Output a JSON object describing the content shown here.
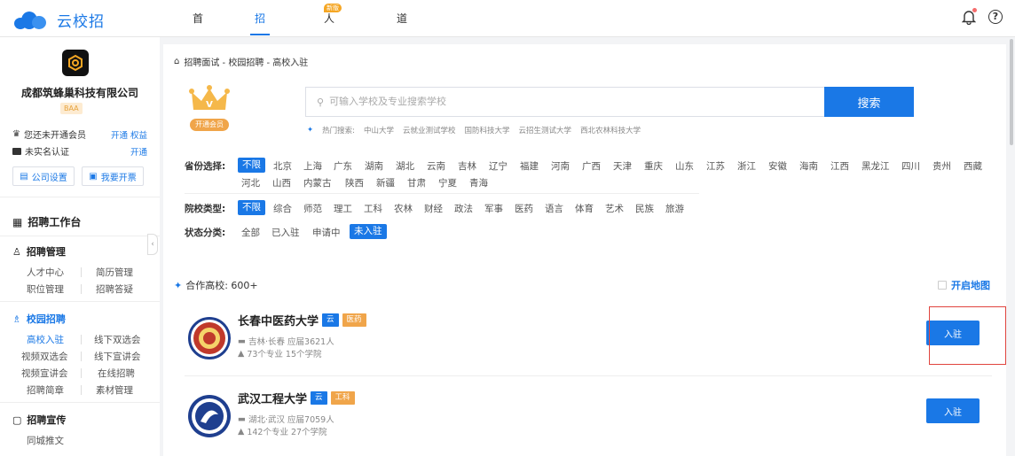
{
  "app": {
    "brand": "云校招",
    "nav": [
      {
        "label": "首页",
        "active": false
      },
      {
        "label": "招聘面试",
        "active": true
      },
      {
        "label": "人事管理",
        "active": false,
        "badge": "新版"
      },
      {
        "label": "道具商城",
        "active": false
      }
    ]
  },
  "sidebar": {
    "company_name": "成都筑蜂巢科技有限公司",
    "badge": "BAA",
    "member_status": "您还未开通会员",
    "member_actions": "开通 权益",
    "verify_status": "未实名认证",
    "verify_action": "开通",
    "btn_company_settings": "公司设置",
    "btn_invoice": "我要开票",
    "workbench": "招聘工作台",
    "recruit_mgmt": {
      "title": "招聘管理",
      "links": [
        "人才中心",
        "简历管理",
        "职位管理",
        "招聘答疑"
      ]
    },
    "campus": {
      "title": "校园招聘",
      "links": [
        "高校入驻",
        "线下双选会",
        "视频双选会",
        "线下宣讲会",
        "视频宣讲会",
        "在线招聘",
        "招聘简章",
        "素材管理"
      ]
    },
    "promo": {
      "title": "招聘宣传",
      "links": [
        "同城推文"
      ]
    }
  },
  "main": {
    "breadcrumb": "招聘面试 - 校园招聘 - 高校入驻",
    "member_tag": "开通会员",
    "search": {
      "placeholder": "可输入学校及专业搜索学校",
      "button": "搜索",
      "hot_label": "热门搜索:",
      "hot": [
        "中山大学",
        "云就业测试学校",
        "国防科技大学",
        "云招生测试大学",
        "西北农林科技大学"
      ]
    },
    "province": {
      "label": "省份选择:",
      "options": [
        "不限",
        "北京",
        "上海",
        "广东",
        "湖南",
        "湖北",
        "云南",
        "吉林",
        "辽宁",
        "福建",
        "河南",
        "广西",
        "天津",
        "重庆",
        "山东",
        "江苏",
        "浙江",
        "安徽",
        "海南",
        "江西",
        "黑龙江",
        "四川",
        "贵州",
        "西藏",
        "河北",
        "山西",
        "内蒙古",
        "陕西",
        "新疆",
        "甘肃",
        "宁夏",
        "青海"
      ],
      "selected": "不限"
    },
    "school_type": {
      "label": "院校类型:",
      "options": [
        "不限",
        "综合",
        "师范",
        "理工",
        "工科",
        "农林",
        "财经",
        "政法",
        "军事",
        "医药",
        "语言",
        "体育",
        "艺术",
        "民族",
        "旅游"
      ],
      "selected": "不限"
    },
    "status": {
      "label": "状态分类:",
      "options": [
        "全部",
        "已入驻",
        "申请中",
        "未入驻"
      ],
      "selected": "未入驻"
    },
    "coop_label": "合作高校: 600+",
    "map_toggle": "开启地图",
    "schools": [
      {
        "name": "长春中医药大学",
        "tag_cloud": "云",
        "tag_type": "医药",
        "location_line": "吉林·长春 应届3621人",
        "majors_line": "73个专业 15个学院",
        "button": "入驻",
        "emblem_color": "#c0392b"
      },
      {
        "name": "武汉工程大学",
        "tag_cloud": "云",
        "tag_type": "工科",
        "location_line": "湖北·武汉 应届7059人",
        "majors_line": "142个专业 27个学院",
        "button": "入驻",
        "emblem_color": "#1f3f8f"
      }
    ]
  }
}
